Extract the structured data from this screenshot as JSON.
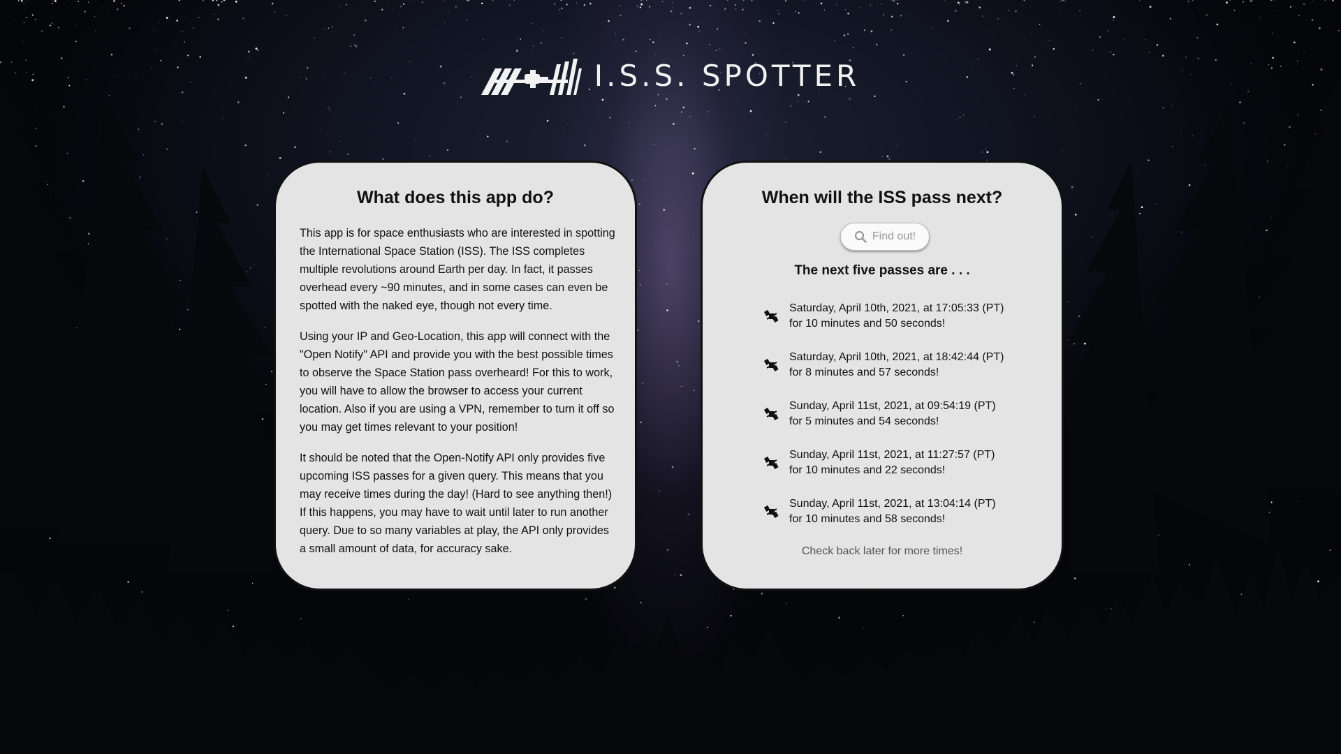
{
  "header": {
    "title": "I.S.S. SPOTTER",
    "logo_icon": "space-station-icon"
  },
  "about": {
    "heading": "What does this app do?",
    "paragraphs": [
      "This app is for space enthusiasts who are interested in spotting the International Space Station (ISS). The ISS completes multiple revolutions around Earth per day. In fact, it passes overhead every ~90 minutes, and in some cases can even be spotted with the naked eye, though not every time.",
      "Using your IP and Geo-Location, this app will connect with the \"Open Notify\" API and provide you with the best possible times to observe the Space Station pass overheard! For this to work, you will have to allow the browser to access your current location. Also if you are using a VPN, remember to turn it off so you may get times relevant to your position!",
      "It should be noted that the Open-Notify API only provides five upcoming ISS passes for a given query. This means that you may receive times during the day! (Hard to see anything then!) If this happens, you may have to wait until later to run another query. Due to so many variables at play, the API only provides a small amount of data, for accuracy sake."
    ]
  },
  "passes_panel": {
    "heading": "When will the ISS pass next?",
    "button_label": "Find out!",
    "button_icon": "search-icon",
    "subheading": "The next five passes are . . .",
    "item_icon": "space-station-icon",
    "passes": [
      {
        "when": "Saturday, April 10th, 2021, at 17:05:33 (PT)",
        "duration": "for 10 minutes and 50 seconds!"
      },
      {
        "when": "Saturday, April 10th, 2021, at 18:42:44 (PT)",
        "duration": "for 8 minutes and 57 seconds!"
      },
      {
        "when": "Sunday, April 11st, 2021, at 09:54:19 (PT)",
        "duration": "for 5 minutes and 54 seconds!"
      },
      {
        "when": "Sunday, April 11st, 2021, at 11:27:57 (PT)",
        "duration": "for 10 minutes and 22 seconds!"
      },
      {
        "when": "Sunday, April 11st, 2021, at 13:04:14 (PT)",
        "duration": "for 10 minutes and 58 seconds!"
      }
    ],
    "footer_note": "Check back later for more times!"
  },
  "colors": {
    "panel_bg": "#e4e4e4",
    "panel_border": "#111111",
    "title": "#f2f2f2",
    "muted_text": "#555555"
  }
}
